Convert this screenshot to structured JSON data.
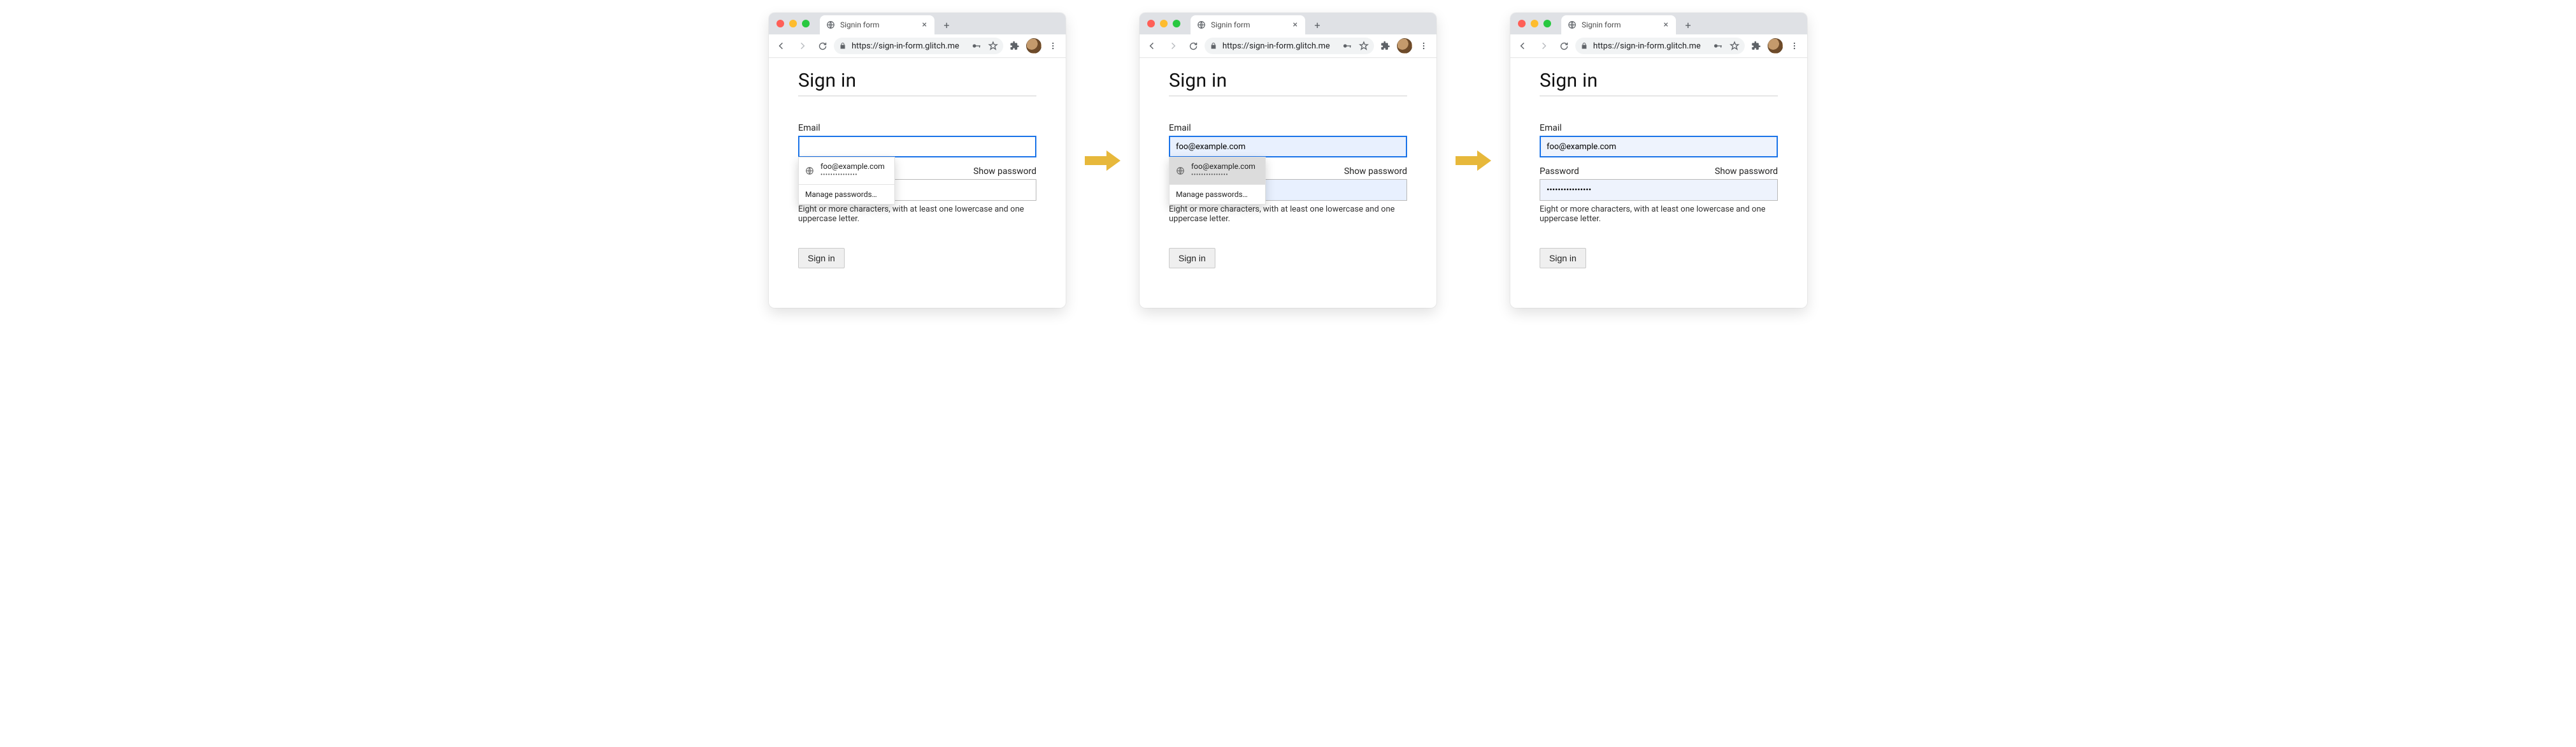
{
  "browser": {
    "tab_title": "Signin form",
    "url": "https://sign-in-form.glitch.me",
    "new_tab_glyph": "+",
    "close_glyph": "×"
  },
  "page": {
    "heading": "Sign in",
    "email_label": "Email",
    "password_label": "Password",
    "show_password": "Show password",
    "helper": "Eight or more characters, with at least one lowercase and one uppercase letter.",
    "submit": "Sign in"
  },
  "autofill": {
    "suggestion_user": "foo@example.com",
    "suggestion_pw_mask": "•••••••••••••••",
    "manage": "Manage passwords…"
  },
  "states": {
    "s1": {
      "email_value": "",
      "password_value": "",
      "dropdown_hover": false
    },
    "s2": {
      "email_value": "foo@example.com",
      "password_value": "",
      "dropdown_hover": true
    },
    "s3": {
      "email_value": "foo@example.com",
      "password_value": "••••••••••••••••"
    }
  }
}
